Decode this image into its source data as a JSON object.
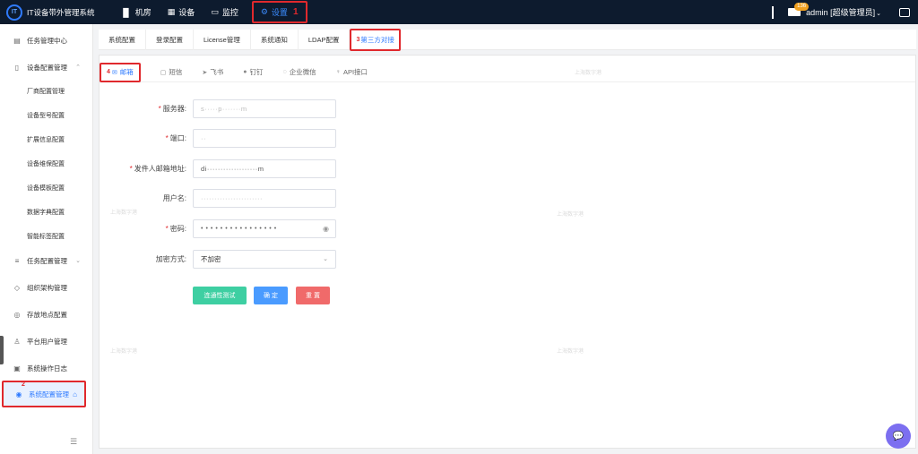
{
  "app": {
    "logo_mark": "IT",
    "title": "IT设备带外管理系统"
  },
  "topnav": [
    {
      "icon": "▐▌",
      "label": "机房"
    },
    {
      "icon": "▦",
      "label": "设备"
    },
    {
      "icon": "▭",
      "label": "监控"
    },
    {
      "icon": "⚙",
      "label": "设置",
      "step": "1"
    }
  ],
  "header_right": {
    "badge": "136",
    "user": "admin [超级管理员]",
    "user_caret": "⌄"
  },
  "sidebar": {
    "items": [
      {
        "icon": "▤",
        "label": "任务管理中心"
      },
      {
        "icon": "▯",
        "label": "设备配置管理",
        "chevron": "⌃"
      },
      {
        "label": "厂商配置管理"
      },
      {
        "label": "设备型号配置"
      },
      {
        "label": "扩展信息配置"
      },
      {
        "label": "设备维保配置"
      },
      {
        "label": "设备模板配置"
      },
      {
        "label": "数据字典配置"
      },
      {
        "label": "智能标签配置"
      },
      {
        "icon": "≡",
        "label": "任务配置管理",
        "chevron": "⌄"
      },
      {
        "icon": "◇",
        "label": "组织架构管理"
      },
      {
        "icon": "◎",
        "label": "存放地点配置"
      },
      {
        "icon": "♙",
        "label": "平台用户管理"
      },
      {
        "icon": "▣",
        "label": "系统操作日志"
      },
      {
        "icon": "◉",
        "label": "系统配置管理",
        "step": "2"
      }
    ],
    "collapse": "☰"
  },
  "main_tabs": [
    {
      "label": "系统配置"
    },
    {
      "label": "登录配置"
    },
    {
      "label": "License管理"
    },
    {
      "label": "系统通知"
    },
    {
      "label": "LDAP配置"
    },
    {
      "label": "第三方对接",
      "step": "3"
    }
  ],
  "sub_tabs": [
    {
      "icon": "✉",
      "label": "邮箱",
      "step": "4"
    },
    {
      "icon": "▢",
      "label": "短信"
    },
    {
      "icon": "➤",
      "label": "飞书"
    },
    {
      "icon": "●",
      "label": "钉钉"
    },
    {
      "icon": "◌",
      "label": "企业微信"
    },
    {
      "icon": "♀",
      "label": "API接口"
    }
  ],
  "form": {
    "server": {
      "label": "服务器:",
      "required": "*",
      "value": "s·····p·······m"
    },
    "port": {
      "label": "端口:",
      "required": "*",
      "value": "··"
    },
    "sender": {
      "label": "发件人邮箱地址:",
      "required": "*",
      "value": "di···················m"
    },
    "username": {
      "label": "用户名:",
      "value": "·······················"
    },
    "password": {
      "label": "密码:",
      "required": "*",
      "value": "••••••••••••••••",
      "eye": "◉"
    },
    "encrypt": {
      "label": "加密方式:",
      "value": "不加密",
      "caret": "⌄"
    }
  },
  "buttons": {
    "test": "连通性测试",
    "ok": "确 定",
    "reset": "重 置"
  },
  "watermark": "上海数字港",
  "chat_icon": "💬"
}
